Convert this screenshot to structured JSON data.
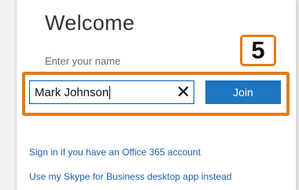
{
  "welcome": {
    "title": "Welcome",
    "name_label": "Enter your name",
    "name_value": "Mark Johnson",
    "clear_glyph": "✕",
    "join_label": "Join"
  },
  "callout": {
    "step_number": "5",
    "color": "#e07c1e"
  },
  "links": [
    "Sign in if you have an Office 365 account",
    "Use my Skype for Business desktop app instead"
  ],
  "colors": {
    "join_button": "#1e76bf",
    "link": "#1c5ea8",
    "input_border": "#0b5aa6"
  },
  "icons": {
    "clear": "close-icon"
  }
}
